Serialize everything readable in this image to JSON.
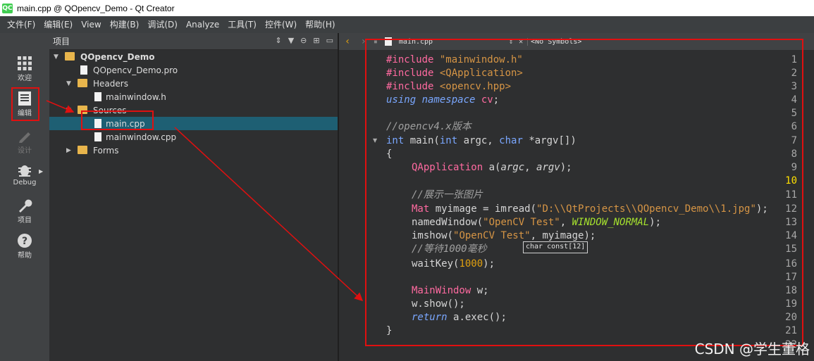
{
  "window": {
    "title": "main.cpp @ QOpencv_Demo - Qt Creator",
    "logo": "QC"
  },
  "menu": [
    "文件(F)",
    "编辑(E)",
    "View",
    "构建(B)",
    "调试(D)",
    "Analyze",
    "工具(T)",
    "控件(W)",
    "帮助(H)"
  ],
  "modes": [
    {
      "label": "欢迎",
      "icon": "grid-icon"
    },
    {
      "label": "编辑",
      "icon": "edit-doc-icon"
    },
    {
      "label": "设计",
      "icon": "pencil-icon"
    },
    {
      "label": "Debug",
      "icon": "bug-icon"
    },
    {
      "label": "项目",
      "icon": "wrench-icon"
    },
    {
      "label": "帮助",
      "icon": "help-icon"
    }
  ],
  "project": {
    "header": "项目",
    "tree": [
      {
        "name": "QOpencv_Demo",
        "type": "project",
        "depth": 0,
        "bold": true
      },
      {
        "name": "QOpencv_Demo.pro",
        "type": "pro",
        "depth": 1
      },
      {
        "name": "Headers",
        "type": "folder",
        "depth": 1
      },
      {
        "name": "mainwindow.h",
        "type": "file",
        "depth": 2
      },
      {
        "name": "Sources",
        "type": "folder",
        "depth": 1
      },
      {
        "name": "main.cpp",
        "type": "file",
        "depth": 2,
        "selected": true
      },
      {
        "name": "mainwindow.cpp",
        "type": "file",
        "depth": 2
      },
      {
        "name": "Forms",
        "type": "folder",
        "depth": 1
      }
    ]
  },
  "editor": {
    "file": "main.cpp",
    "symbols": "<No Symbols>",
    "current_line": "10",
    "lines": [
      "1",
      "2",
      "3",
      "4",
      "5",
      "6",
      "7",
      "8",
      "9",
      "10",
      "11",
      "12",
      "13",
      "14",
      "15",
      "16",
      "17",
      "18",
      "19",
      "20",
      "21",
      "22"
    ],
    "tooltip": "char const[12]"
  },
  "code": {
    "l1a": "#include ",
    "l1b": "\"mainwindow.h\"",
    "l2a": "#include ",
    "l2b": "<QApplication>",
    "l3a": "#include ",
    "l3b": "<opencv.hpp>",
    "l4a": "using namespace ",
    "l4b": "cv",
    ";": ";",
    "l6": "//opencv4.x版本",
    "l7a": "int ",
    "l7b": "main(",
    "l7c": "int ",
    "l7d": "argc, ",
    "l7e": "char ",
    "l7f": "*argv[])",
    "l8": "{",
    "l9a": "QApplication ",
    "l9b": "a(",
    "l9c": "argc",
    "l9d": ", ",
    "l9e": "argv",
    "l9f": ");",
    "l11": "//展示一张图片",
    "l12a": "Mat ",
    "l12b": "myimage = imread(",
    "l12c": "\"D:\\\\QtProjects\\\\QOpencv_Demo\\\\1.jpg\"",
    "l12d": ");",
    "l13a": "namedWindow(",
    "l13b": "\"OpenCV Test\"",
    "l13c": ", ",
    "l13d": "WINDOW_NORMAL",
    "l13e": ");",
    "l14a": "imshow(",
    "l14b": "\"OpenCV Test\"",
    "l14c": ", myimage);",
    "l15": "//等待1000毫秒",
    "l16a": "waitKey(",
    "l16b": "1000",
    "l16c": ");",
    "l18a": "MainWindow ",
    "l18b": "w;",
    "l19": "w.show();",
    "l20a": "return ",
    "l20b": "a.exec();",
    "l21": "}"
  },
  "watermark": "CSDN @学生董格"
}
